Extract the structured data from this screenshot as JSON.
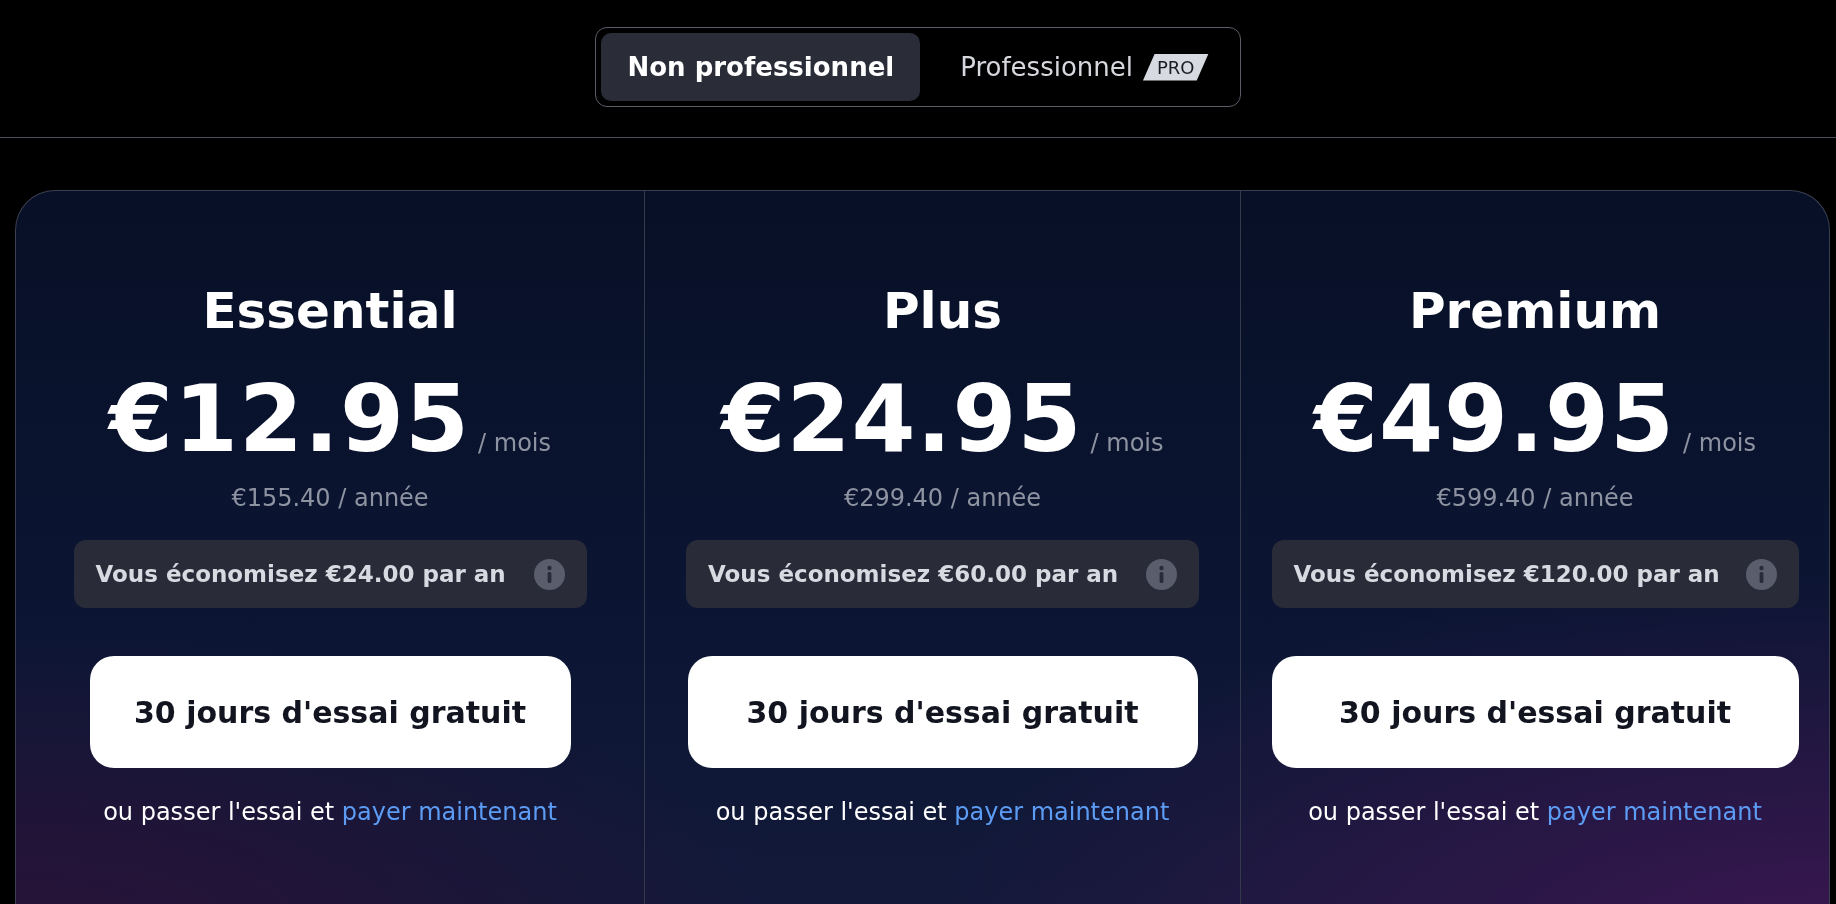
{
  "segmented_control": {
    "options": [
      {
        "label": "Non professionnel",
        "selected": true
      },
      {
        "label": "Professionnel",
        "badge": "PRO",
        "selected": false
      }
    ]
  },
  "plans": [
    {
      "name": "Essential",
      "price": "€12.95",
      "period": "/ mois",
      "yearly": "€155.40 / année",
      "savings": "Vous économisez €24.00 par an",
      "button": "30 jours d'essai gratuit",
      "footer_text": "ou passer l'essai et",
      "footer_link": "payer maintenant"
    },
    {
      "name": "Plus",
      "price": "€24.95",
      "period": "/ mois",
      "yearly": "€299.40 / année",
      "savings": "Vous économisez €60.00 par an",
      "button": "30 jours d'essai gratuit",
      "footer_text": "ou passer l'essai et",
      "footer_link": "payer maintenant"
    },
    {
      "name": "Premium",
      "price": "€49.95",
      "period": "/ mois",
      "yearly": "€599.40 / année",
      "savings": "Vous économisez €120.00 par an",
      "button": "30 jours d'essai gratuit",
      "footer_text": "ou passer l'essai et",
      "footer_link": "payer maintenant"
    }
  ]
}
